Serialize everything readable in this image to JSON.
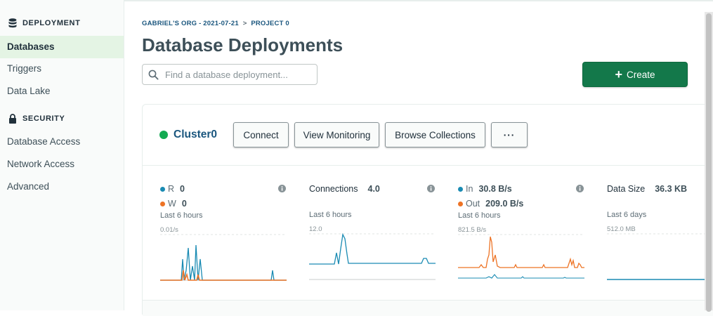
{
  "sidebar": {
    "deployment_header": "DEPLOYMENT",
    "deployment_items": [
      {
        "label": "Databases",
        "active": true
      },
      {
        "label": "Triggers",
        "active": false
      },
      {
        "label": "Data Lake",
        "active": false
      }
    ],
    "security_header": "SECURITY",
    "security_items": [
      {
        "label": "Database Access"
      },
      {
        "label": "Network Access"
      },
      {
        "label": "Advanced"
      }
    ],
    "icons": {
      "deployment": "database-stack-icon",
      "security": "lock-icon"
    }
  },
  "breadcrumb": {
    "org": "GABRIEL'S ORG - 2021-07-21",
    "separator": ">",
    "project": "PROJECT 0"
  },
  "page_title": "Database Deployments",
  "search": {
    "placeholder": "Find a database deployment..."
  },
  "create_button": {
    "label": "Create",
    "icon": "plus-icon"
  },
  "cluster": {
    "name": "Cluster0",
    "status_color": "#13aa52",
    "buttons": {
      "connect": "Connect",
      "view_monitoring": "View Monitoring",
      "browse_collections": "Browse Collections",
      "more": "···"
    }
  },
  "colors": {
    "accent_green": "#13784a",
    "series_blue": "#1a8bb3",
    "series_orange": "#ed7325",
    "link": "#1a567e"
  },
  "metrics": [
    {
      "id": "ops",
      "lines": [
        {
          "label": "R",
          "value": "0",
          "color": "#1a8bb3"
        },
        {
          "label": "W",
          "value": "0",
          "color": "#ed7325"
        }
      ],
      "period": "Last 6 hours",
      "max_label": "0.01/s"
    },
    {
      "id": "connections",
      "lines": [
        {
          "label": "Connections",
          "value": "4.0"
        }
      ],
      "period": "Last 6 hours",
      "max_label": "12.0"
    },
    {
      "id": "network",
      "lines": [
        {
          "label": "In",
          "value": "30.8 B/s",
          "color": "#1a8bb3"
        },
        {
          "label": "Out",
          "value": "209.0 B/s",
          "color": "#ed7325"
        }
      ],
      "period": "Last 6 hours",
      "max_label": "821.5 B/s"
    },
    {
      "id": "data-size",
      "lines": [
        {
          "label": "Data Size",
          "value": "36.3 KB"
        }
      ],
      "period": "Last 6 days",
      "max_label": "512.0 MB"
    }
  ]
}
